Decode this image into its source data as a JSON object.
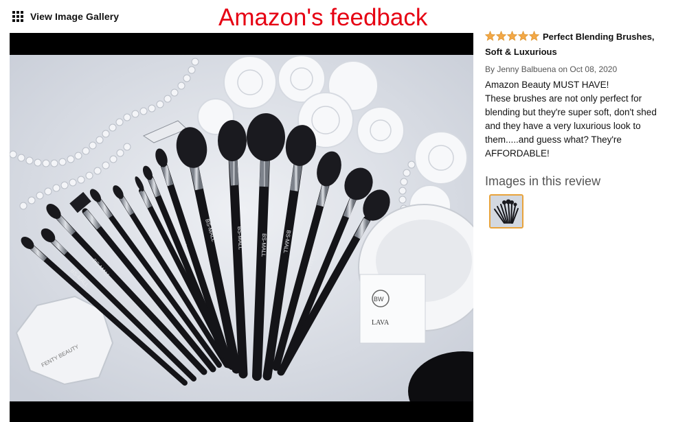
{
  "header": {
    "gallery_link_label": "View Image Gallery",
    "banner_title": "Amazon's feedback"
  },
  "review": {
    "rating": 5,
    "title": "Perfect Blending Brushes, Soft & Luxurious",
    "byline": "By Jenny Balbuena on Oct 08, 2020",
    "body_lines": [
      "Amazon Beauty MUST HAVE!",
      "These brushes are not only perfect for blending but they're super soft, don't shed and they have a very luxurious look to them.....and guess what? They're AFFORDABLE!"
    ]
  },
  "images_section": {
    "heading": "Images in this review",
    "thumbnail_count": 1
  },
  "photo": {
    "brush_brand": "BS-MALL",
    "palette_brand": "FENTY BEAUTY",
    "candle_label": "LAVA",
    "candle_logo": "BW"
  },
  "colors": {
    "banner_red": "#e60012",
    "star_orange": "#f3a847",
    "thumb_border": "#e8a23a",
    "brush_black": "#141418",
    "ferrule_silver": "#b8bcc4"
  },
  "icons": {
    "gallery": "grid-icon",
    "rating": "star-icon"
  }
}
